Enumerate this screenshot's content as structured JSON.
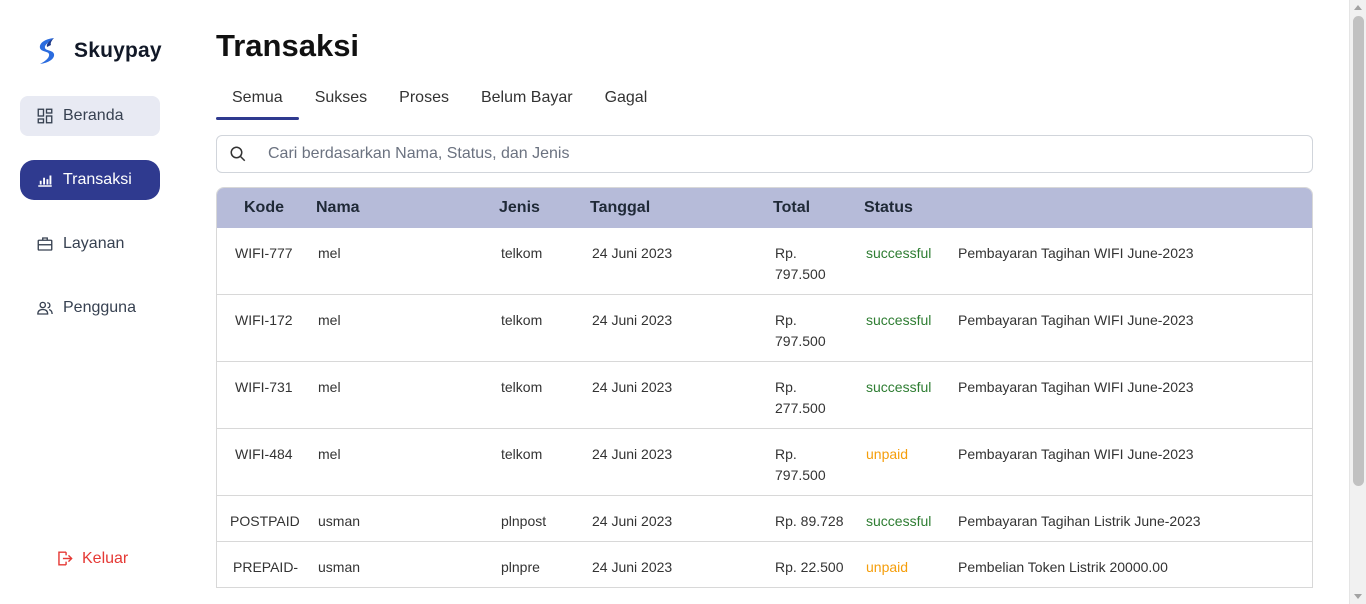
{
  "brand": {
    "name": "Skuypay",
    "accent": "#2f3a8f",
    "logo_color": "#2b6cdf"
  },
  "sidebar": {
    "items": [
      {
        "label": "Beranda",
        "icon": "dashboard-icon"
      },
      {
        "label": "Transaksi",
        "icon": "bar-chart-icon"
      },
      {
        "label": "Layanan",
        "icon": "briefcase-icon"
      },
      {
        "label": "Pengguna",
        "icon": "users-icon"
      }
    ],
    "logout_label": "Keluar",
    "logout_color": "#e53935"
  },
  "page": {
    "title": "Transaksi"
  },
  "tabs": [
    "Semua",
    "Sukses",
    "Proses",
    "Belum Bayar",
    "Gagal"
  ],
  "search": {
    "placeholder": "Cari berdasarkan Nama, Status, dan Jenis",
    "value": ""
  },
  "table": {
    "headers": [
      "Kode",
      "Nama",
      "Jenis",
      "Tanggal",
      "Total",
      "Status"
    ],
    "rows": [
      {
        "kode": "WIFI-777",
        "nama": "mel",
        "jenis": "telkom",
        "tanggal": "24 Juni 2023",
        "total": "Rp. 797.500",
        "status": "successful",
        "keterangan": "Pembayaran Tagihan WIFI June-2023"
      },
      {
        "kode": "WIFI-172",
        "nama": "mel",
        "jenis": "telkom",
        "tanggal": "24 Juni 2023",
        "total": "Rp. 797.500",
        "status": "successful",
        "keterangan": "Pembayaran Tagihan WIFI June-2023"
      },
      {
        "kode": "WIFI-731",
        "nama": "mel",
        "jenis": "telkom",
        "tanggal": "24 Juni 2023",
        "total": "Rp. 277.500",
        "status": "successful",
        "keterangan": "Pembayaran Tagihan WIFI June-2023"
      },
      {
        "kode": "WIFI-484",
        "nama": "mel",
        "jenis": "telkom",
        "tanggal": "24 Juni 2023",
        "total": "Rp. 797.500",
        "status": "unpaid",
        "keterangan": "Pembayaran Tagihan WIFI June-2023"
      },
      {
        "kode": "POSTPAID",
        "nama": "usman",
        "jenis": "plnpost",
        "tanggal": "24 Juni 2023",
        "total": "Rp. 89.728",
        "status": "successful",
        "keterangan": "Pembayaran Tagihan Listrik June-2023"
      },
      {
        "kode": "PREPAID-",
        "nama": "usman",
        "jenis": "plnpre",
        "tanggal": "24 Juni 2023",
        "total": "Rp. 22.500",
        "status": "unpaid",
        "keterangan": "Pembelian Token Listrik 20000.00"
      }
    ]
  },
  "status_colors": {
    "successful": "#2e7d32",
    "unpaid": "#f59e0b"
  }
}
